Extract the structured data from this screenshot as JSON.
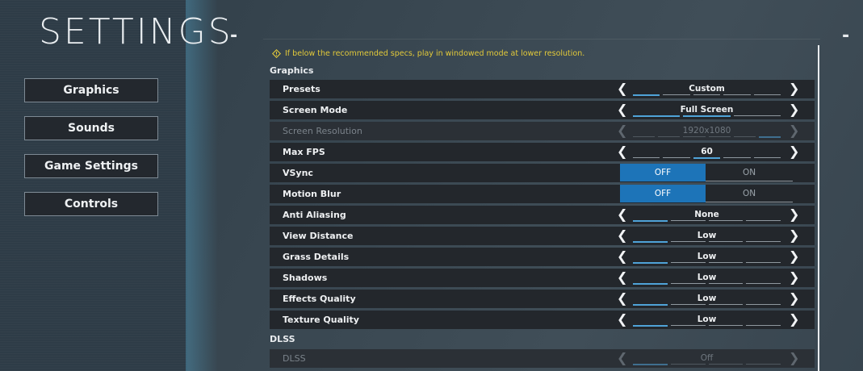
{
  "title": "SETTINGS",
  "nav": {
    "items": [
      {
        "label": "Graphics"
      },
      {
        "label": "Sounds"
      },
      {
        "label": "Game Settings"
      },
      {
        "label": "Controls"
      }
    ]
  },
  "warning": "If below the recommended specs, play in windowed mode at lower resolution.",
  "sections": {
    "graphics_label": "Graphics",
    "dlss_label": "DLSS"
  },
  "graphics": {
    "presets": {
      "label": "Presets",
      "value": "Custom"
    },
    "screen_mode": {
      "label": "Screen Mode",
      "value": "Full Screen"
    },
    "screen_resolution": {
      "label": "Screen Resolution",
      "value": "1920x1080"
    },
    "max_fps": {
      "label": "Max FPS",
      "value": "60"
    },
    "vsync": {
      "label": "VSync",
      "off": "OFF",
      "on": "ON"
    },
    "motion_blur": {
      "label": "Motion Blur",
      "off": "OFF",
      "on": "ON"
    },
    "anti_aliasing": {
      "label": "Anti Aliasing",
      "value": "None"
    },
    "view_distance": {
      "label": "View Distance",
      "value": "Low"
    },
    "grass_details": {
      "label": "Grass Details",
      "value": "Low"
    },
    "shadows": {
      "label": "Shadows",
      "value": "Low"
    },
    "effects_quality": {
      "label": "Effects Quality",
      "value": "Low"
    },
    "texture_quality": {
      "label": "Texture Quality",
      "value": "Low"
    }
  },
  "dlss": {
    "label": "DLSS",
    "value": "Off"
  },
  "colors": {
    "accent": "#1d74b8",
    "warning": "#e2c93a",
    "row_bg": "#23272c"
  },
  "icons": {
    "prev": "chevron-left-icon",
    "next": "chevron-right-icon",
    "warning": "warning-diamond-icon"
  }
}
